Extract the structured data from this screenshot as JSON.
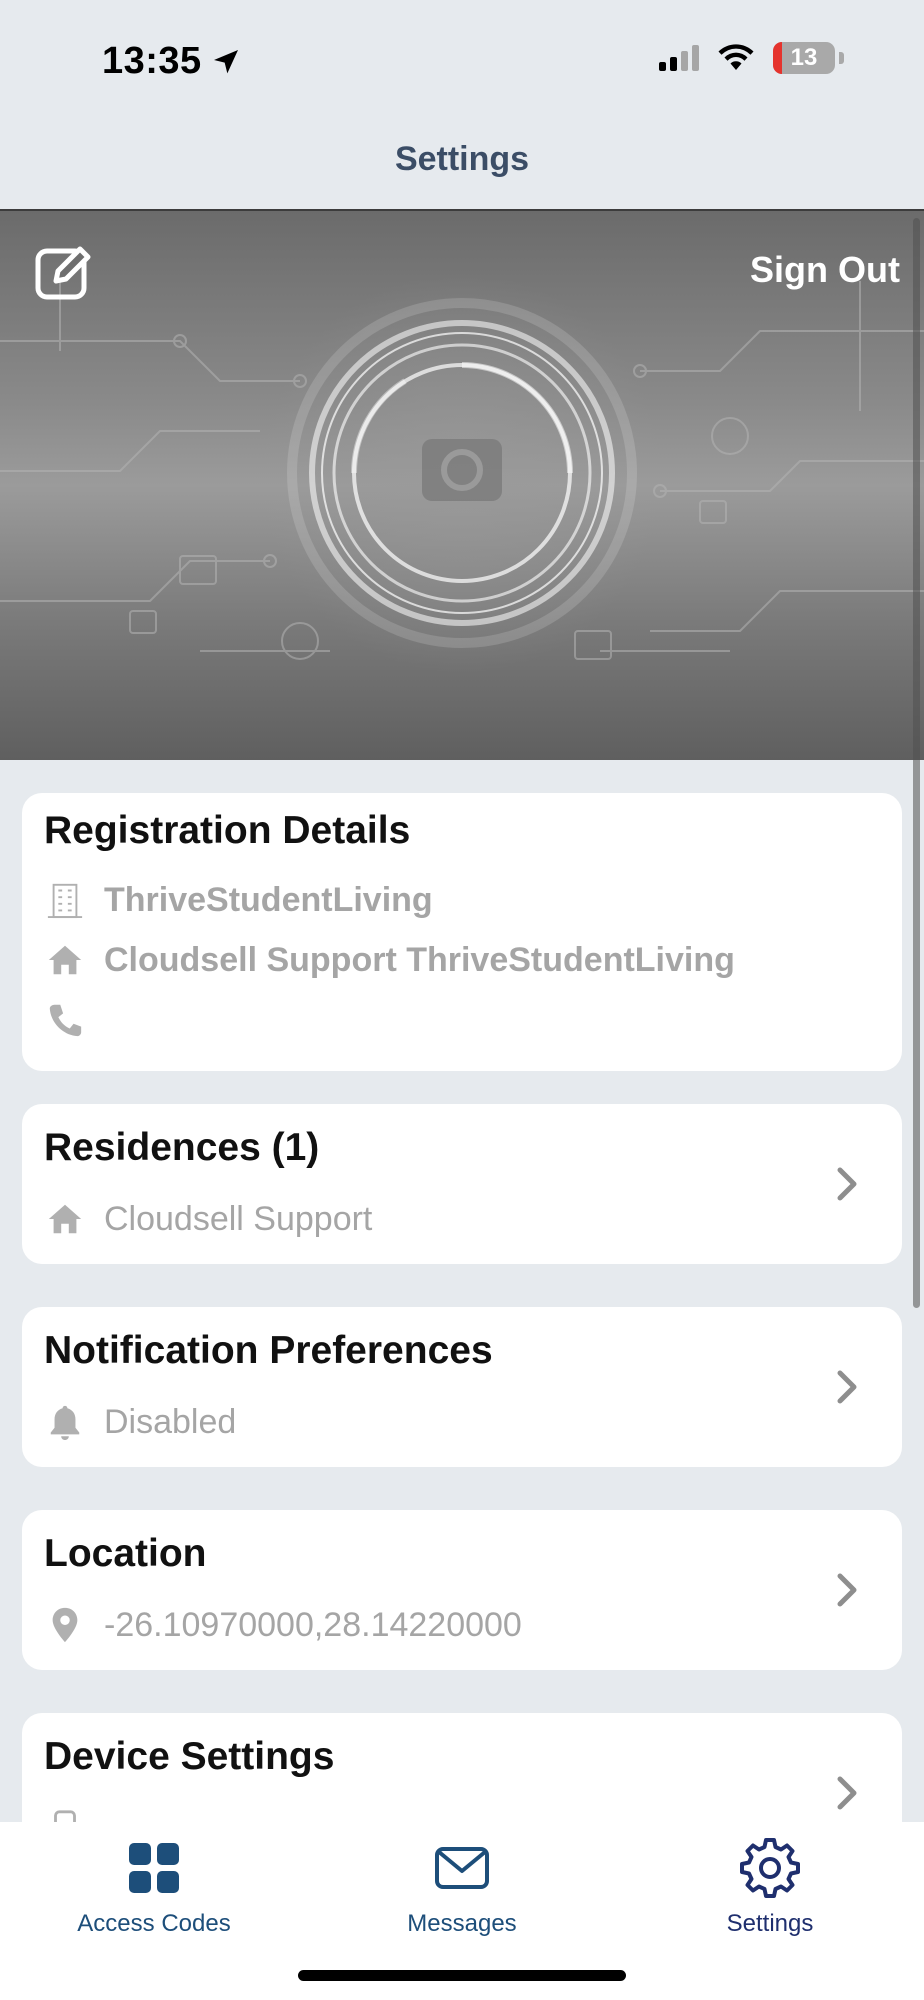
{
  "status_bar": {
    "time": "13:35",
    "battery": "13",
    "icons": [
      "location-arrow-icon",
      "cellular-signal-icon",
      "wifi-icon",
      "battery-icon"
    ]
  },
  "nav": {
    "title": "Settings"
  },
  "hero": {
    "sign_out_label": "Sign Out",
    "edit_icon": "edit-icon"
  },
  "registration": {
    "title": "Registration Details",
    "company": "ThriveStudentLiving",
    "address": "Cloudsell Support ThriveStudentLiving",
    "phone": ""
  },
  "residences": {
    "title": "Residences (1)",
    "value": "Cloudsell Support"
  },
  "notifications": {
    "title": "Notification Preferences",
    "value": "Disabled"
  },
  "location": {
    "title": "Location",
    "value": "-26.10970000,28.14220000"
  },
  "device": {
    "title": "Device Settings"
  },
  "tabs": [
    {
      "label": "Access Codes",
      "icon": "grid-icon"
    },
    {
      "label": "Messages",
      "icon": "envelope-icon"
    },
    {
      "label": "Settings",
      "icon": "gear-icon"
    }
  ],
  "colors": {
    "accent": "#1d4e7a",
    "muted_text": "#a5a5a5",
    "background": "#e6eaee"
  }
}
